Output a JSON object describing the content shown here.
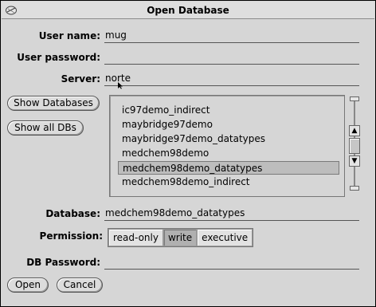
{
  "window": {
    "title": "Open Database"
  },
  "form": {
    "user_name_label": "User name:",
    "user_name_value": "mug",
    "user_password_label": "User password:",
    "user_password_value": "",
    "server_label": "Server:",
    "server_value": "norte",
    "database_label": "Database:",
    "database_value": "medchem98demo_datatypes",
    "permission_label": "Permission:",
    "db_password_label": "DB Password:",
    "db_password_value": ""
  },
  "buttons": {
    "show_databases": "Show Databases",
    "show_all_dbs": "Show all DBs",
    "open": "Open",
    "cancel": "Cancel"
  },
  "database_list": {
    "items": [
      "ic97demo_indirect",
      "maybridge97demo",
      "maybridge97demo_datatypes",
      "medchem98demo",
      "medchem98demo_datatypes",
      "medchem98demo_indirect"
    ],
    "selected": "medchem98demo_datatypes"
  },
  "permission": {
    "options": [
      "read-only",
      "write",
      "executive"
    ],
    "selected": "write"
  }
}
